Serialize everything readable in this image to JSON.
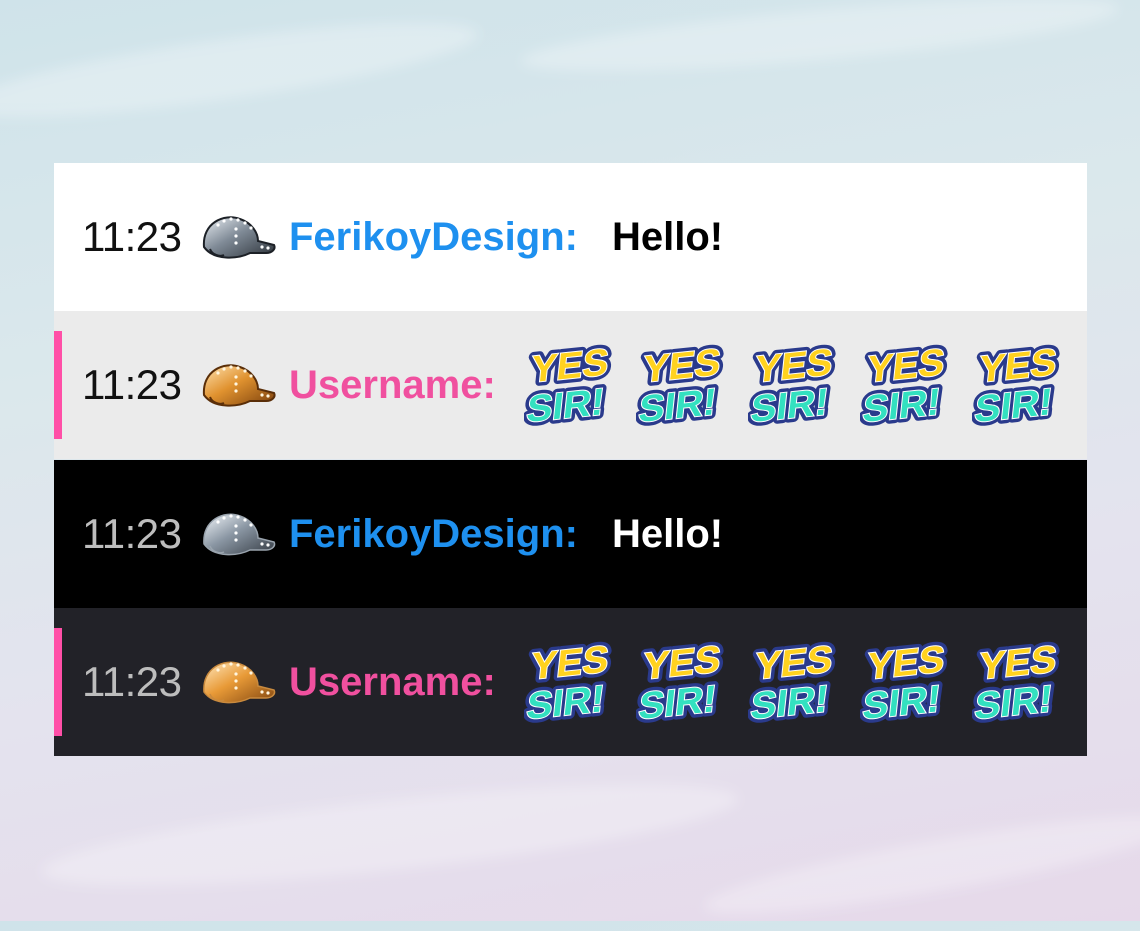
{
  "rows": [
    {
      "time": "11:23",
      "badge": "silver-cap-icon",
      "username": "FerikoyDesign:",
      "message": "Hello!",
      "theme": "light"
    },
    {
      "time": "11:23",
      "badge": "gold-cap-icon",
      "username": "Username:",
      "emote_name": "yes-sir-emote",
      "emote_text_top": "YES",
      "emote_text_bottom": "SIR!",
      "emote_count": 5,
      "theme": "light-highlight"
    },
    {
      "time": "11:23",
      "badge": "silver-cap-icon",
      "username": "FerikoyDesign:",
      "message": "Hello!",
      "theme": "dark"
    },
    {
      "time": "11:23",
      "badge": "gold-cap-icon",
      "username": "Username:",
      "emote_name": "yes-sir-emote",
      "emote_text_top": "YES",
      "emote_text_bottom": "SIR!",
      "emote_count": 5,
      "theme": "dark-highlight"
    }
  ],
  "colors": {
    "accent_pink": "#f0509f",
    "highlight_bar": "#ff4fa7",
    "username_blue": "#1e90ef",
    "emote_yellow": "#ffd21f",
    "emote_teal": "#33e0c0",
    "emote_outline": "#2a3a8c"
  }
}
